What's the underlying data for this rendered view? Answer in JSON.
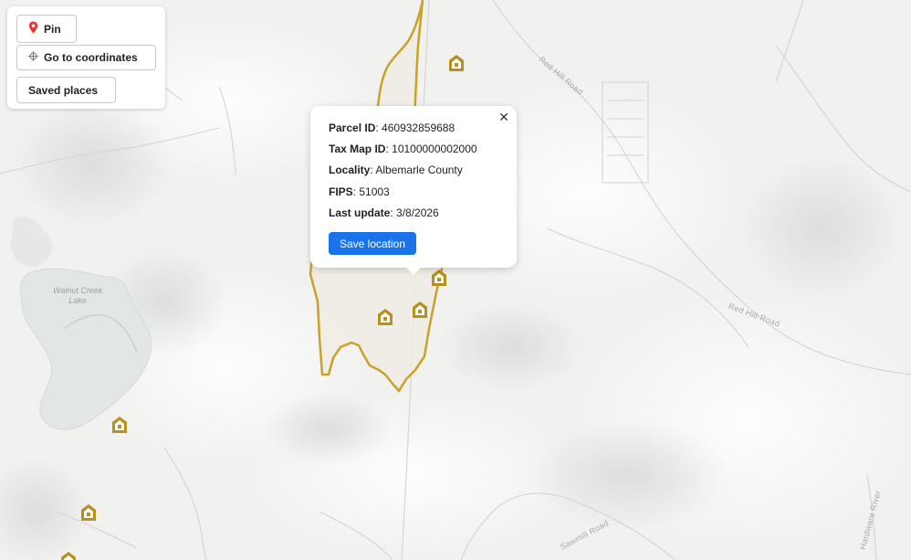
{
  "toolbar": {
    "pin_label": "Pin",
    "pin_icon": "map-pin-icon",
    "coordinates_label": "Go to coordinates",
    "coordinates_icon": "crosshair-icon",
    "saved_places_label": "Saved places"
  },
  "map": {
    "lake_label": "Walnut Creek Lake",
    "lake_label_line1": "Walnut Creek",
    "lake_label_line2": "Lake",
    "road_labels": {
      "red_hill_road_north": "Red Hill Road",
      "red_hill_road_east": "Red Hill Road",
      "road_bottom": "Sawmill Road",
      "river_bottom_right": "Hardware River"
    },
    "parcel_outline_color": "#c9a227",
    "marker_color": "#b8901e"
  },
  "popup": {
    "close_icon": "close-icon",
    "parcel_id_label": "Parcel ID",
    "parcel_id_value": "460932859688",
    "tax_map_label": "Tax Map ID",
    "tax_map_value": "10100000002000",
    "locality_label": "Locality",
    "locality_value": "Albemarle County",
    "fips_label": "FIPS",
    "fips_value": "51003",
    "last_update_label": "Last update",
    "last_update_value": "3/8/2026",
    "save_button_label": "Save location",
    "save_button_color": "#1a73e8"
  },
  "markers": [
    {
      "name": "house-marker-1",
      "icon": "house-marker-icon"
    },
    {
      "name": "house-marker-2",
      "icon": "house-marker-icon"
    },
    {
      "name": "house-marker-3",
      "icon": "house-marker-icon"
    },
    {
      "name": "house-marker-4",
      "icon": "house-marker-icon"
    },
    {
      "name": "house-marker-5",
      "icon": "house-marker-icon"
    },
    {
      "name": "house-marker-6",
      "icon": "house-marker-icon"
    },
    {
      "name": "house-marker-7",
      "icon": "house-marker-icon"
    }
  ]
}
